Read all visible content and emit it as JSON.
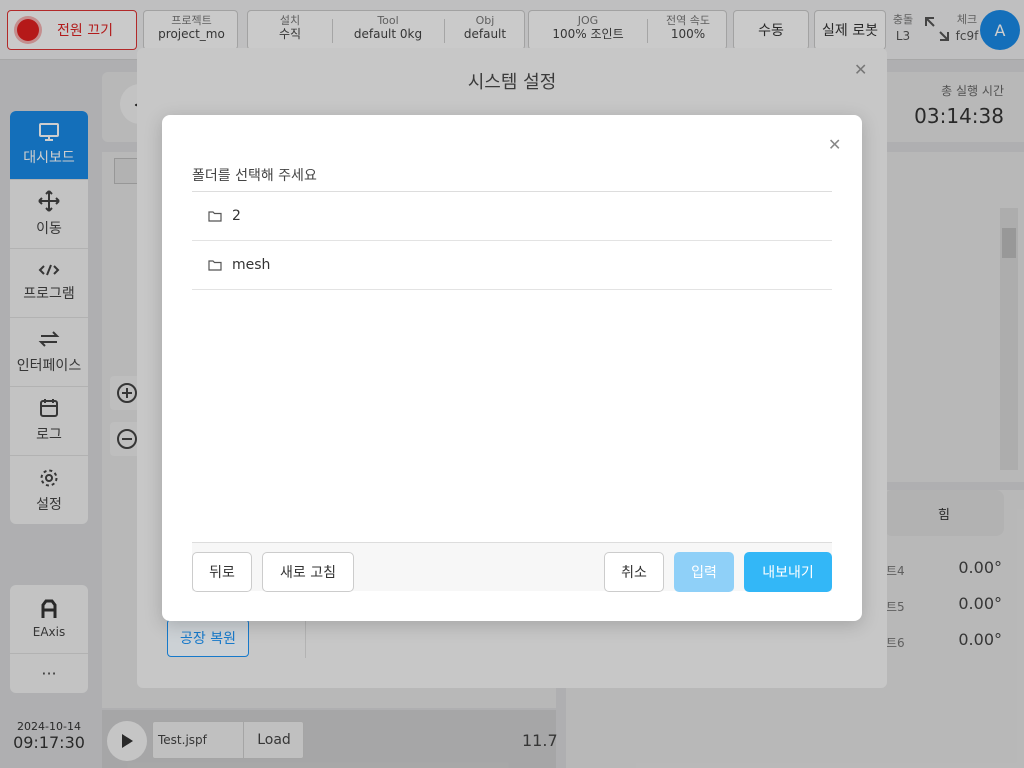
{
  "topbar": {
    "power_label": "전원 끄기",
    "project_key": "프로젝트",
    "project_val": "project_mo",
    "install_key": "설치",
    "install_val": "수직",
    "tool_key": "Tool",
    "tool_val": "default 0kg",
    "obj_key": "Obj",
    "obj_val": "default",
    "jog_key": "JOG",
    "jog_val": "100% 조인트",
    "global_speed_key": "전역 속도",
    "global_speed_val": "100%",
    "manual_label": "수동",
    "real_robot_label": "실제 로봇",
    "collision_key": "충돌",
    "collision_val": "L3",
    "check_key": "체크",
    "check_val": "fc9f",
    "avatar_letter": "A"
  },
  "nav": {
    "items": [
      {
        "label": "대시보드",
        "icon": "monitor-icon"
      },
      {
        "label": "이동",
        "icon": "move-icon"
      },
      {
        "label": "프로그램",
        "icon": "code-icon"
      },
      {
        "label": "인터페이스",
        "icon": "swap-icon"
      },
      {
        "label": "로그",
        "icon": "calendar-icon"
      },
      {
        "label": "설정",
        "icon": "gear-icon"
      }
    ],
    "eaxis_label": "EAxis",
    "more_label": "···"
  },
  "datetime": {
    "date": "2024-10-14",
    "time": "09:17:30"
  },
  "dashboard": {
    "total_runtime_label": "총 실행 시간",
    "total_runtime": "03:14:38",
    "force_label": "힘",
    "joints": [
      {
        "label": "트4",
        "value": "0.00°"
      },
      {
        "label": "트5",
        "value": "0.00°"
      },
      {
        "label": "트6",
        "value": "0.00°"
      }
    ],
    "program_file": "Test.jspf",
    "load_label": "Load",
    "speed_value": "11.7"
  },
  "system_modal": {
    "title": "시스템 설정",
    "factory_reset_label": "공장 복원"
  },
  "folder_dialog": {
    "title": "폴더를 선택해 주세요",
    "folders": [
      "2",
      "mesh"
    ],
    "back_label": "뒤로",
    "refresh_label": "새로 고침",
    "cancel_label": "취소",
    "enter_label": "입력",
    "export_label": "내보내기"
  }
}
